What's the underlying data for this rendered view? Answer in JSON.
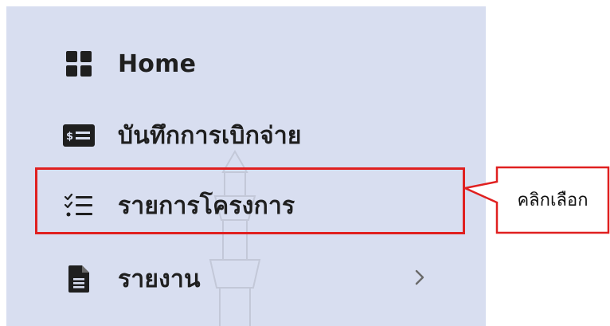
{
  "sidebar": {
    "items": [
      {
        "label": "Home",
        "icon": "grid-icon"
      },
      {
        "label": "บันทึกการเบิกจ่าย",
        "icon": "dollar-list-icon"
      },
      {
        "label": "รายการโครงการ",
        "icon": "checklist-icon"
      },
      {
        "label": "รายงาน",
        "icon": "document-icon",
        "has_submenu": true
      }
    ]
  },
  "callout": {
    "text": "คลิกเลือก",
    "border_color": "#e02020"
  },
  "colors": {
    "sidebar_bg": "#d8def0",
    "text": "#1f1f1f",
    "highlight": "#e02020"
  }
}
